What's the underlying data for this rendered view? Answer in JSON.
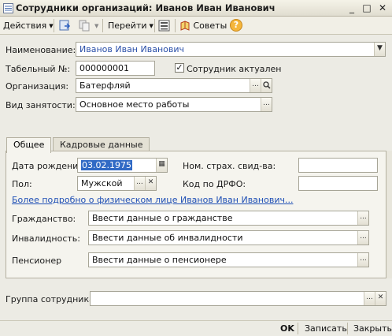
{
  "window": {
    "title": "Сотрудники организаций: Иванов Иван Иванович",
    "controls": [
      "_",
      "□",
      "✕"
    ]
  },
  "toolbar": {
    "actions_label": "Действия",
    "goto_label": "Перейти",
    "tips_label": "Советы",
    "help_label": "?"
  },
  "form": {
    "name_label": "Наименование:",
    "name_value": "Иванов Иван Иванович",
    "tab_number_label": "Табельный №:",
    "tab_number_value": "000000001",
    "actual_label": "Сотрудник актуален",
    "actual_checked": true,
    "org_label": "Организация:",
    "org_value": "Батерфляй",
    "employment_label": "Вид занятости:",
    "employment_value": "Основное место работы"
  },
  "tabs": [
    {
      "label": "Общее",
      "active": true
    },
    {
      "label": "Кадровые данные",
      "active": false
    }
  ],
  "general": {
    "birth_label": "Дата рождения:",
    "birth_value": "03.02.1975",
    "insurance_label": "Ном. страх. свид-ва:",
    "insurance_value": "",
    "gender_label": "Пол:",
    "gender_value": "Мужской",
    "drfo_label": "Код по ДРФО:",
    "drfo_value": "",
    "more_link": "Более подробно о физическом лице Иванов Иван Иванович...",
    "citizenship_label": "Гражданство:",
    "citizenship_value": "Ввести данные о гражданстве",
    "disability_label": "Инвалидность:",
    "disability_value": "Ввести данные об инвалидности",
    "pensioner_label": "Пенсионер",
    "pensioner_value": "Ввести данные о пенсионере"
  },
  "group": {
    "label": "Группа сотрудника:",
    "value": ""
  },
  "footer": {
    "ok_label": "OK",
    "save_label": "Записать",
    "close_label": "Закрыть"
  },
  "colors": {
    "link": "#1f4fb5",
    "selection": "#316ac5"
  }
}
